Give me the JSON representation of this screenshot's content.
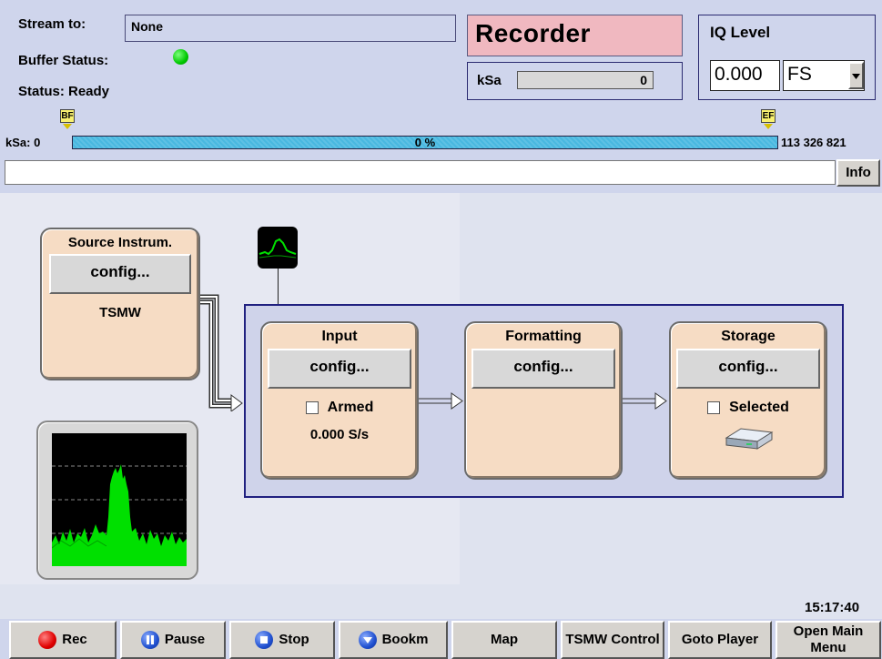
{
  "header": {
    "stream_label": "Stream to:",
    "stream_value": "None",
    "buffer_label": "Buffer Status:",
    "status_text": "Status: Ready",
    "recorder_title": "Recorder",
    "ksa_label": "kSa",
    "ksa_value": "0",
    "iq_level_label": "IQ Level",
    "iq_value": "0.000",
    "iq_unit": "FS",
    "buffer_led_color": "#00c800"
  },
  "progress": {
    "start_label": "kSa: 0",
    "percent_text": "0 %",
    "end_label": "113 326 821",
    "begin_marker": "BF",
    "end_marker": "EF"
  },
  "info": {
    "button_label": "Info",
    "value": ""
  },
  "source": {
    "title": "Source Instrum.",
    "config_label": "config...",
    "device": "TSMW"
  },
  "chain": {
    "input": {
      "title": "Input",
      "config_label": "config...",
      "armed_label": "Armed",
      "rate": "0.000 S/s"
    },
    "formatting": {
      "title": "Formatting",
      "config_label": "config..."
    },
    "storage": {
      "title": "Storage",
      "config_label": "config...",
      "selected_label": "Selected"
    }
  },
  "clock": "15:17:40",
  "toolbar": {
    "rec": "Rec",
    "pause": "Pause",
    "stop": "Stop",
    "bookm": "Bookm",
    "map": "Map",
    "tsmw_control": "TSMW Control",
    "goto_player": "Goto Player",
    "open_main_menu": "Open Main Menu"
  },
  "colors": {
    "recorder_bg": "#f0b8c0",
    "progress_fill": "#48b8e0",
    "spectrum_trace": "#00e000",
    "block_bg": "#f6dcc4",
    "frame_border": "#202080"
  }
}
